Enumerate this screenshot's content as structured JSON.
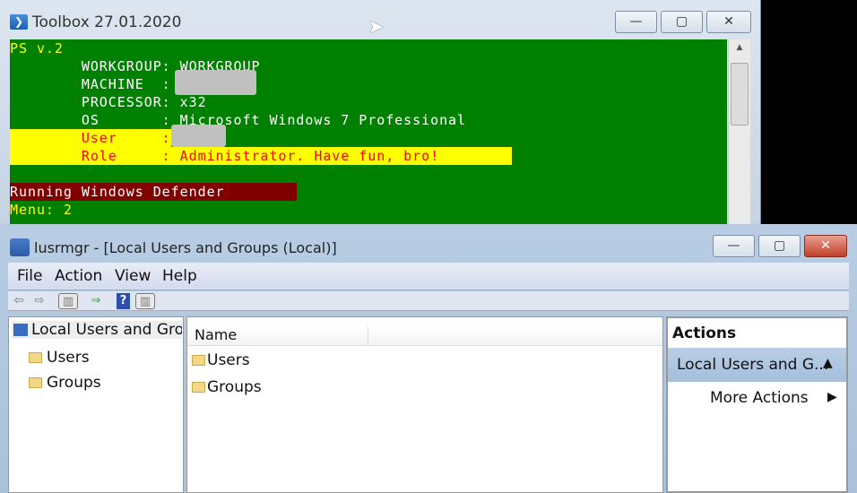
{
  "toolbox": {
    "title": "Toolbox 27.01.2020",
    "minimize": "—",
    "maximize": "▢",
    "close": "✕",
    "lines": {
      "ps": "PS v.2",
      "workgroup": "        WORKGROUP: WORKGROUP",
      "machine": "        MACHINE  :",
      "processor": "        PROCESSOR: x32",
      "os": "        OS       : Microsoft Windows 7 Professional",
      "user": "        User     :",
      "role": "        Role     : Administrator. Have fun, bro!",
      "defender": "Running Windows Defender",
      "menu": "Menu: 2"
    }
  },
  "lusrmgr": {
    "title": "lusrmgr - [Local Users and Groups (Local)]",
    "menu": [
      "File",
      "Action",
      "View",
      "Help"
    ],
    "tree": {
      "root": "Local Users and Grou",
      "items": [
        "Users",
        "Groups"
      ]
    },
    "list": {
      "header": "Name",
      "items": [
        "Users",
        "Groups"
      ]
    },
    "actions": {
      "header": "Actions",
      "section": "Local Users and G...",
      "more": "More Actions"
    }
  },
  "colors": {
    "console_bg": "#008000",
    "highlight": "#ffff00",
    "defender_bg": "#800000"
  }
}
